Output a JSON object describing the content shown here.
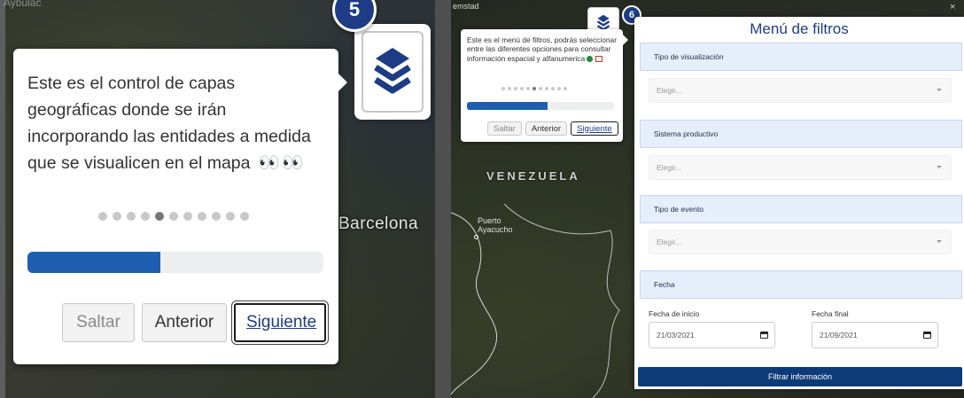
{
  "left_panel": {
    "corner_text": "Aybulac",
    "map_label": "Barcelona",
    "step_number": "5",
    "tour_text": "Este es el control de capas geográficas donde se irán incorporando las entidades a medida que se visualicen en el mapa",
    "eyes_emoji": "👀👀",
    "progress_fraction": 0.45,
    "buttons": {
      "skip": "Saltar",
      "previous": "Anterior",
      "next": "Siguiente"
    }
  },
  "right_panel": {
    "corner_text": "emstad",
    "map_label_country": "VENEZUELA",
    "map_label_city": "Puerto Ayacucho",
    "step_number": "6",
    "close_label": "×",
    "tour_text": "Este es el menú de filtros, podrás seleccionar entre las diferentes opciones para consultar información espacial y alfanumerica",
    "progress_fraction": 0.55,
    "buttons": {
      "skip": "Saltar",
      "previous": "Anterior",
      "next": "Siguiente"
    }
  },
  "filters": {
    "title": "Menú de filtros",
    "sections": [
      {
        "label": "Tipo de visualización",
        "placeholder": "Elegir..."
      },
      {
        "label": "Sistema productivo",
        "placeholder": "Elegir..."
      },
      {
        "label": "Tipo de evento",
        "placeholder": "Elegir..."
      }
    ],
    "date_section": "Fecha",
    "start_label": "Fecha de inicio",
    "start_value": "21/03/2021",
    "end_label": "Fecha final",
    "end_value": "21/09/2021",
    "submit_label": "Filtrar información"
  },
  "colors": {
    "accent": "#1d3c85",
    "progress": "#1d5fae",
    "section_bg": "#e6eefc",
    "submit_bg": "#0d3b78"
  },
  "icons": [
    "layers-icon",
    "calendar-icon",
    "eyes-icon",
    "globe-icon",
    "chart-icon",
    "chevron-down-icon"
  ]
}
